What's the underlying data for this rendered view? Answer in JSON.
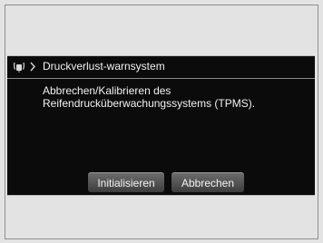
{
  "header": {
    "icon": "tpms-tire-icon",
    "title": "Druckverlust-warnsystem"
  },
  "message": {
    "line1": "Abbrechen/Kalibrieren des",
    "line2": "Reifendrucküberwachungssystems (TPMS)."
  },
  "buttons": {
    "initialize_label": "Initialisieren",
    "cancel_label": "Abbrechen"
  }
}
